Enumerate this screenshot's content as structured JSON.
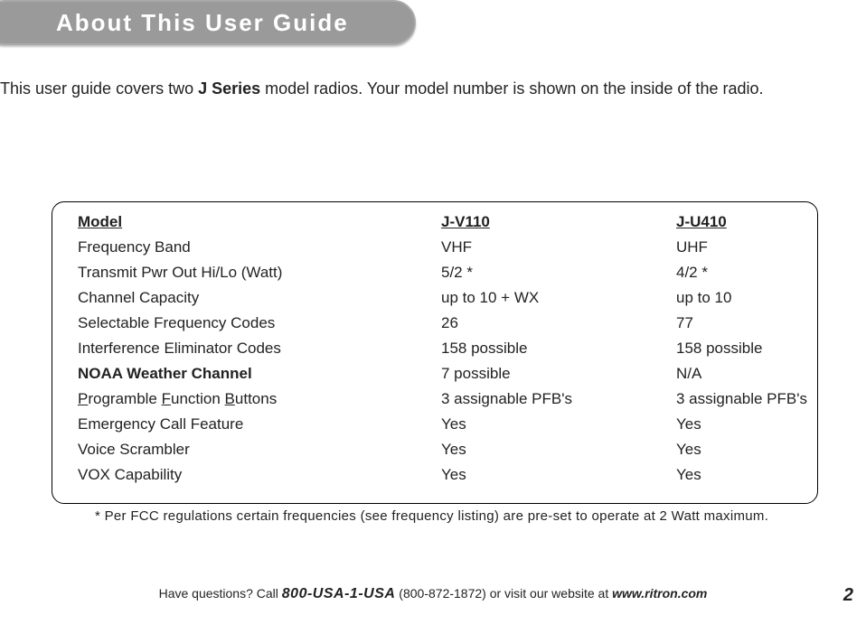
{
  "title": "About This User Guide",
  "intro_prefix": "This user guide covers two ",
  "intro_bold": "J Series",
  "intro_suffix": " model radios. Your model number is shown on the inside of the radio.",
  "table": {
    "header": {
      "label": "Model",
      "col_a": "J-V110",
      "col_b": "J-U410"
    },
    "rows": [
      {
        "label": "Frequency Band",
        "a": "VHF",
        "b": "UHF",
        "bold": false
      },
      {
        "label": "Transmit Pwr Out Hi/Lo (Watt)",
        "a": "5/2 *",
        "b": "4/2 *",
        "bold": false
      },
      {
        "label": "Channel Capacity",
        "a": "up to 10 + WX",
        "b": "up to 10",
        "bold": false
      },
      {
        "label": "Selectable Frequency  Codes",
        "a": "26",
        "b": "77",
        "bold": false
      },
      {
        "label": "Interference Eliminator Codes",
        "a": "158 possible",
        "b": "158 possible",
        "bold": false
      },
      {
        "label": "NOAA Weather Channel",
        "a": "7 possible",
        "b": "N/A",
        "bold": true
      },
      {
        "label_html": true,
        "parts": [
          "P",
          "rogramble ",
          "F",
          "unction ",
          "B",
          "uttons"
        ],
        "a": "3 assignable PFB's",
        "b": "3 assignable PFB's",
        "bold": false
      },
      {
        "label": "Emergency Call Feature",
        "a": "Yes",
        "b": "Yes",
        "bold": false
      },
      {
        "label": "Voice Scrambler",
        "a": "Yes",
        "b": "Yes",
        "bold": false
      },
      {
        "label": "VOX Capability",
        "a": "Yes",
        "b": "Yes",
        "bold": false
      }
    ]
  },
  "footnote": "* Per FCC regulations certain frequencies (see frequency listing) are pre-set to operate at 2 Watt maximum.",
  "footer": {
    "prefix": "Have questions? Call ",
    "phone_vanity": "800-USA-1-USA",
    "phone_paren": " (800-872-1872) or visit our website at ",
    "site": "www.ritron.com"
  },
  "page_number": "2"
}
